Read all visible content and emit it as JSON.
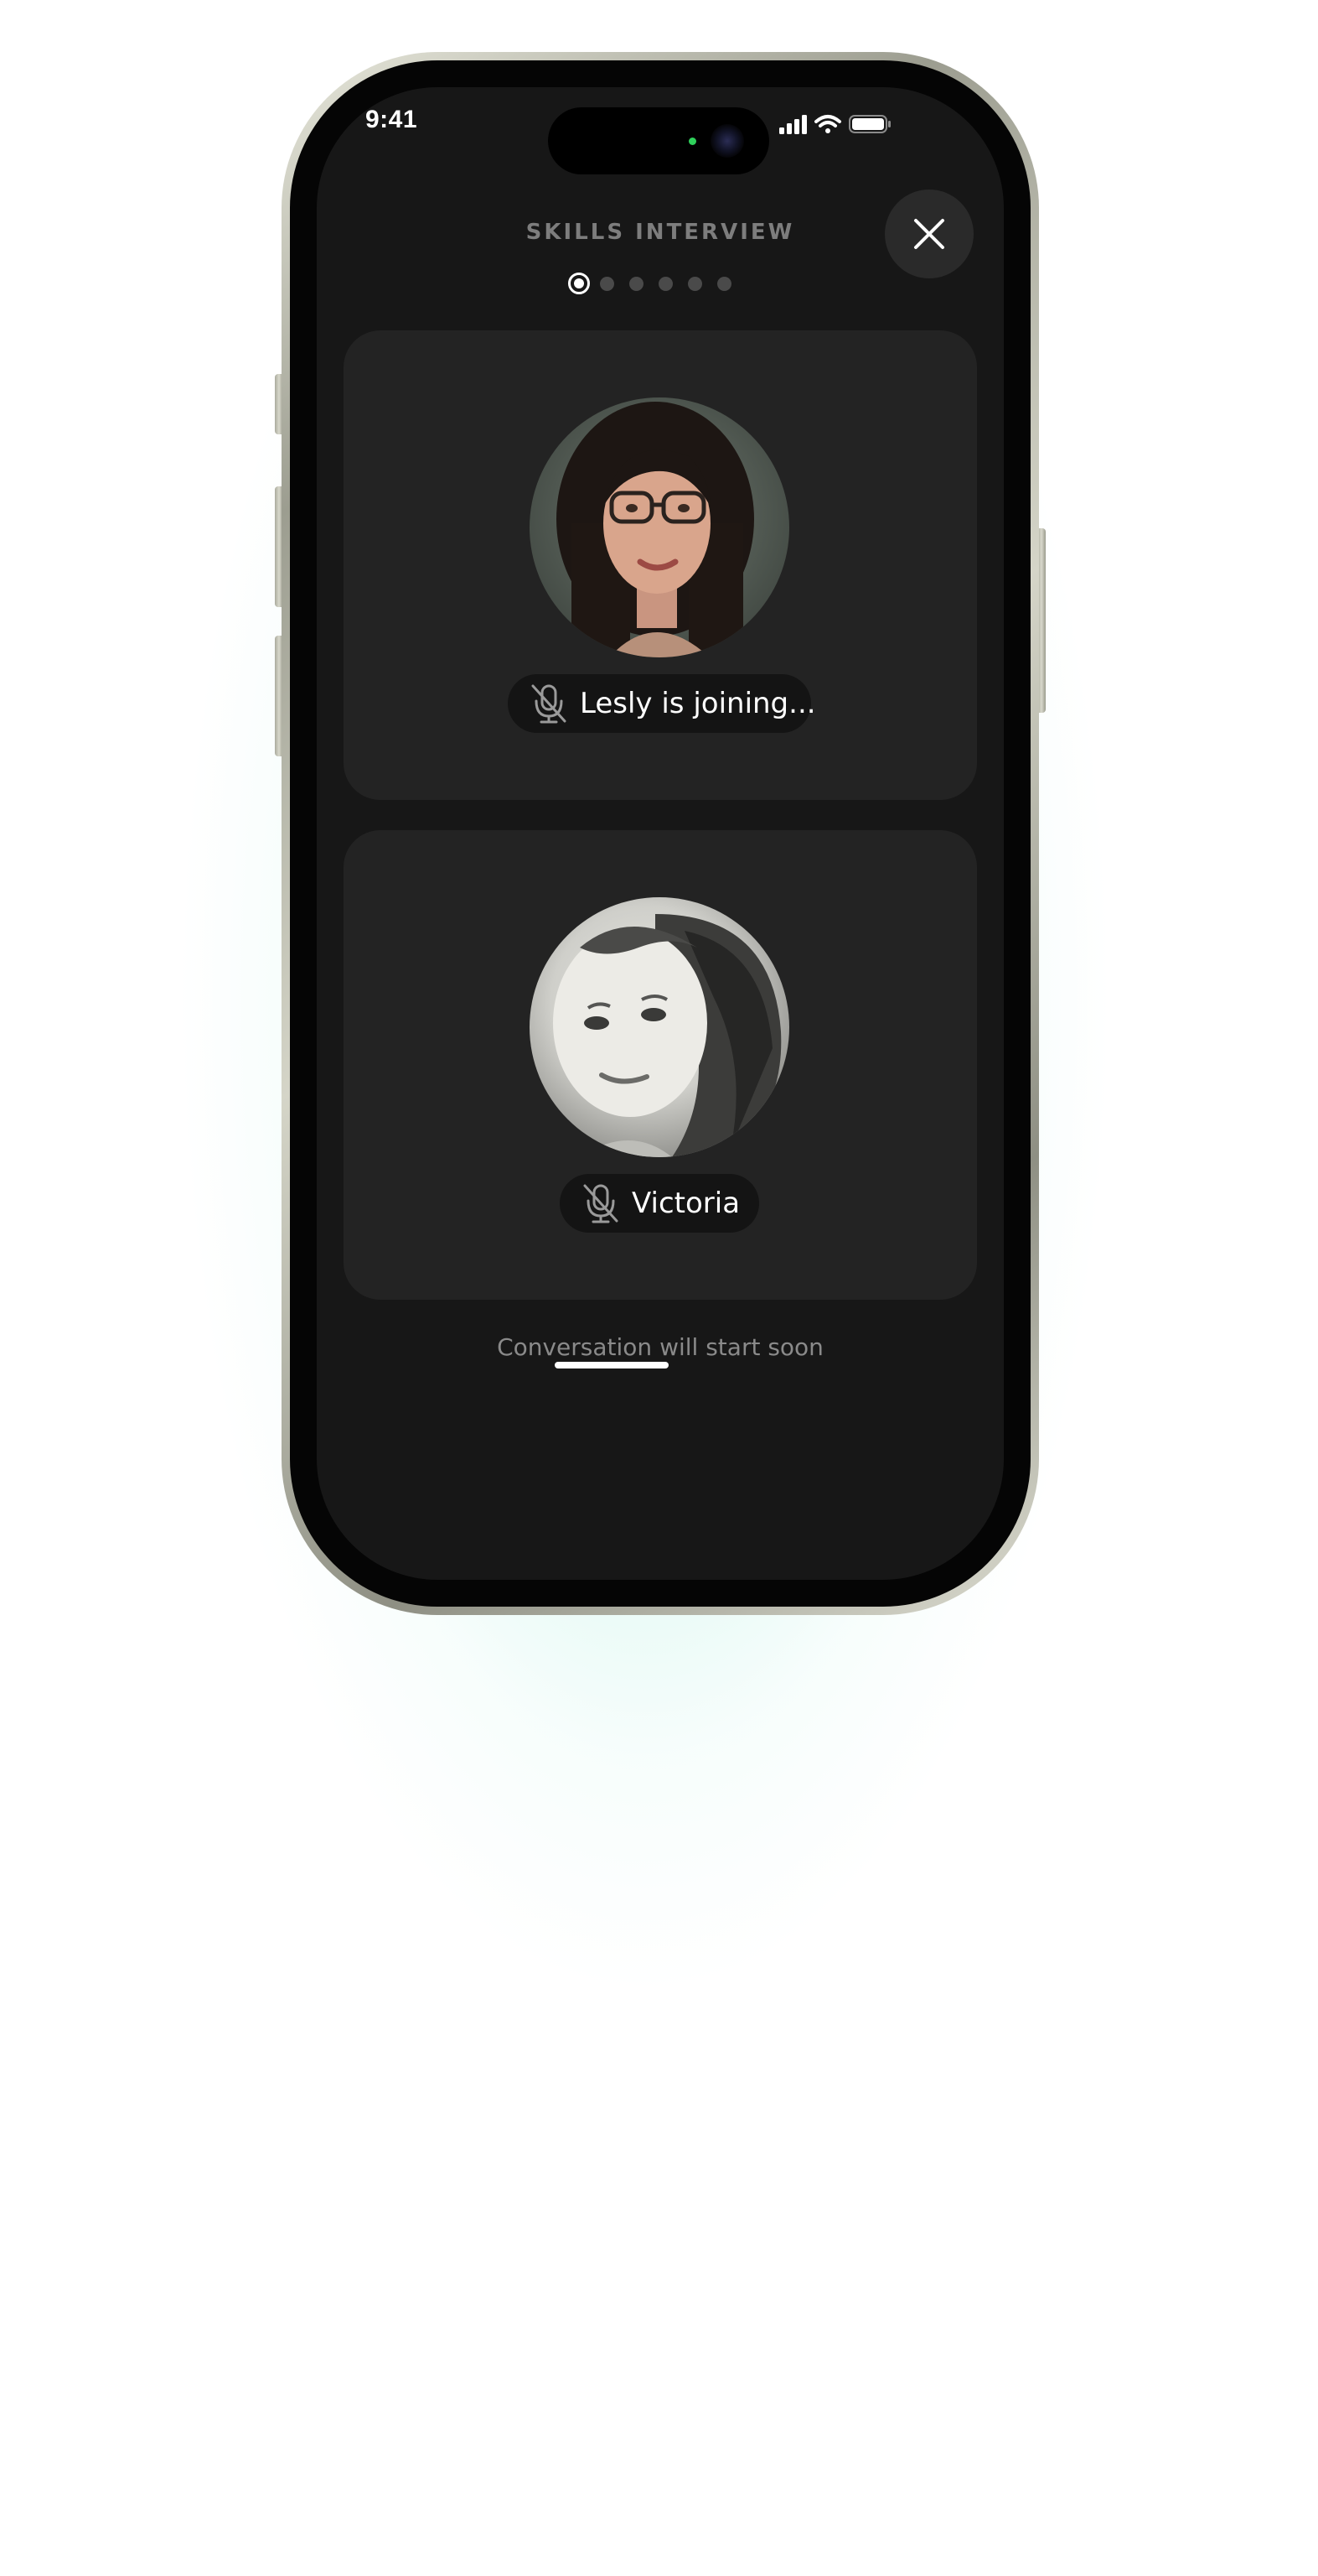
{
  "status_bar": {
    "time": "9:41",
    "icons": [
      "cellular-signal-icon",
      "wifi-icon",
      "battery-icon"
    ]
  },
  "header": {
    "title": "SKILLS INTERVIEW",
    "close_icon": "close-icon",
    "steps": {
      "total": 6,
      "current": 1
    }
  },
  "participants": [
    {
      "name": "Lesly is joining...",
      "mic_icon": "mic-off-icon",
      "muted": true
    },
    {
      "name": "Victoria",
      "mic_icon": "mic-off-icon",
      "muted": true
    }
  ],
  "footer": {
    "status_text": "Conversation will start soon"
  },
  "colors": {
    "screen_bg": "#171717",
    "card_bg": "#232323",
    "pill_bg": "#141414",
    "glow": "#78e1cd"
  }
}
